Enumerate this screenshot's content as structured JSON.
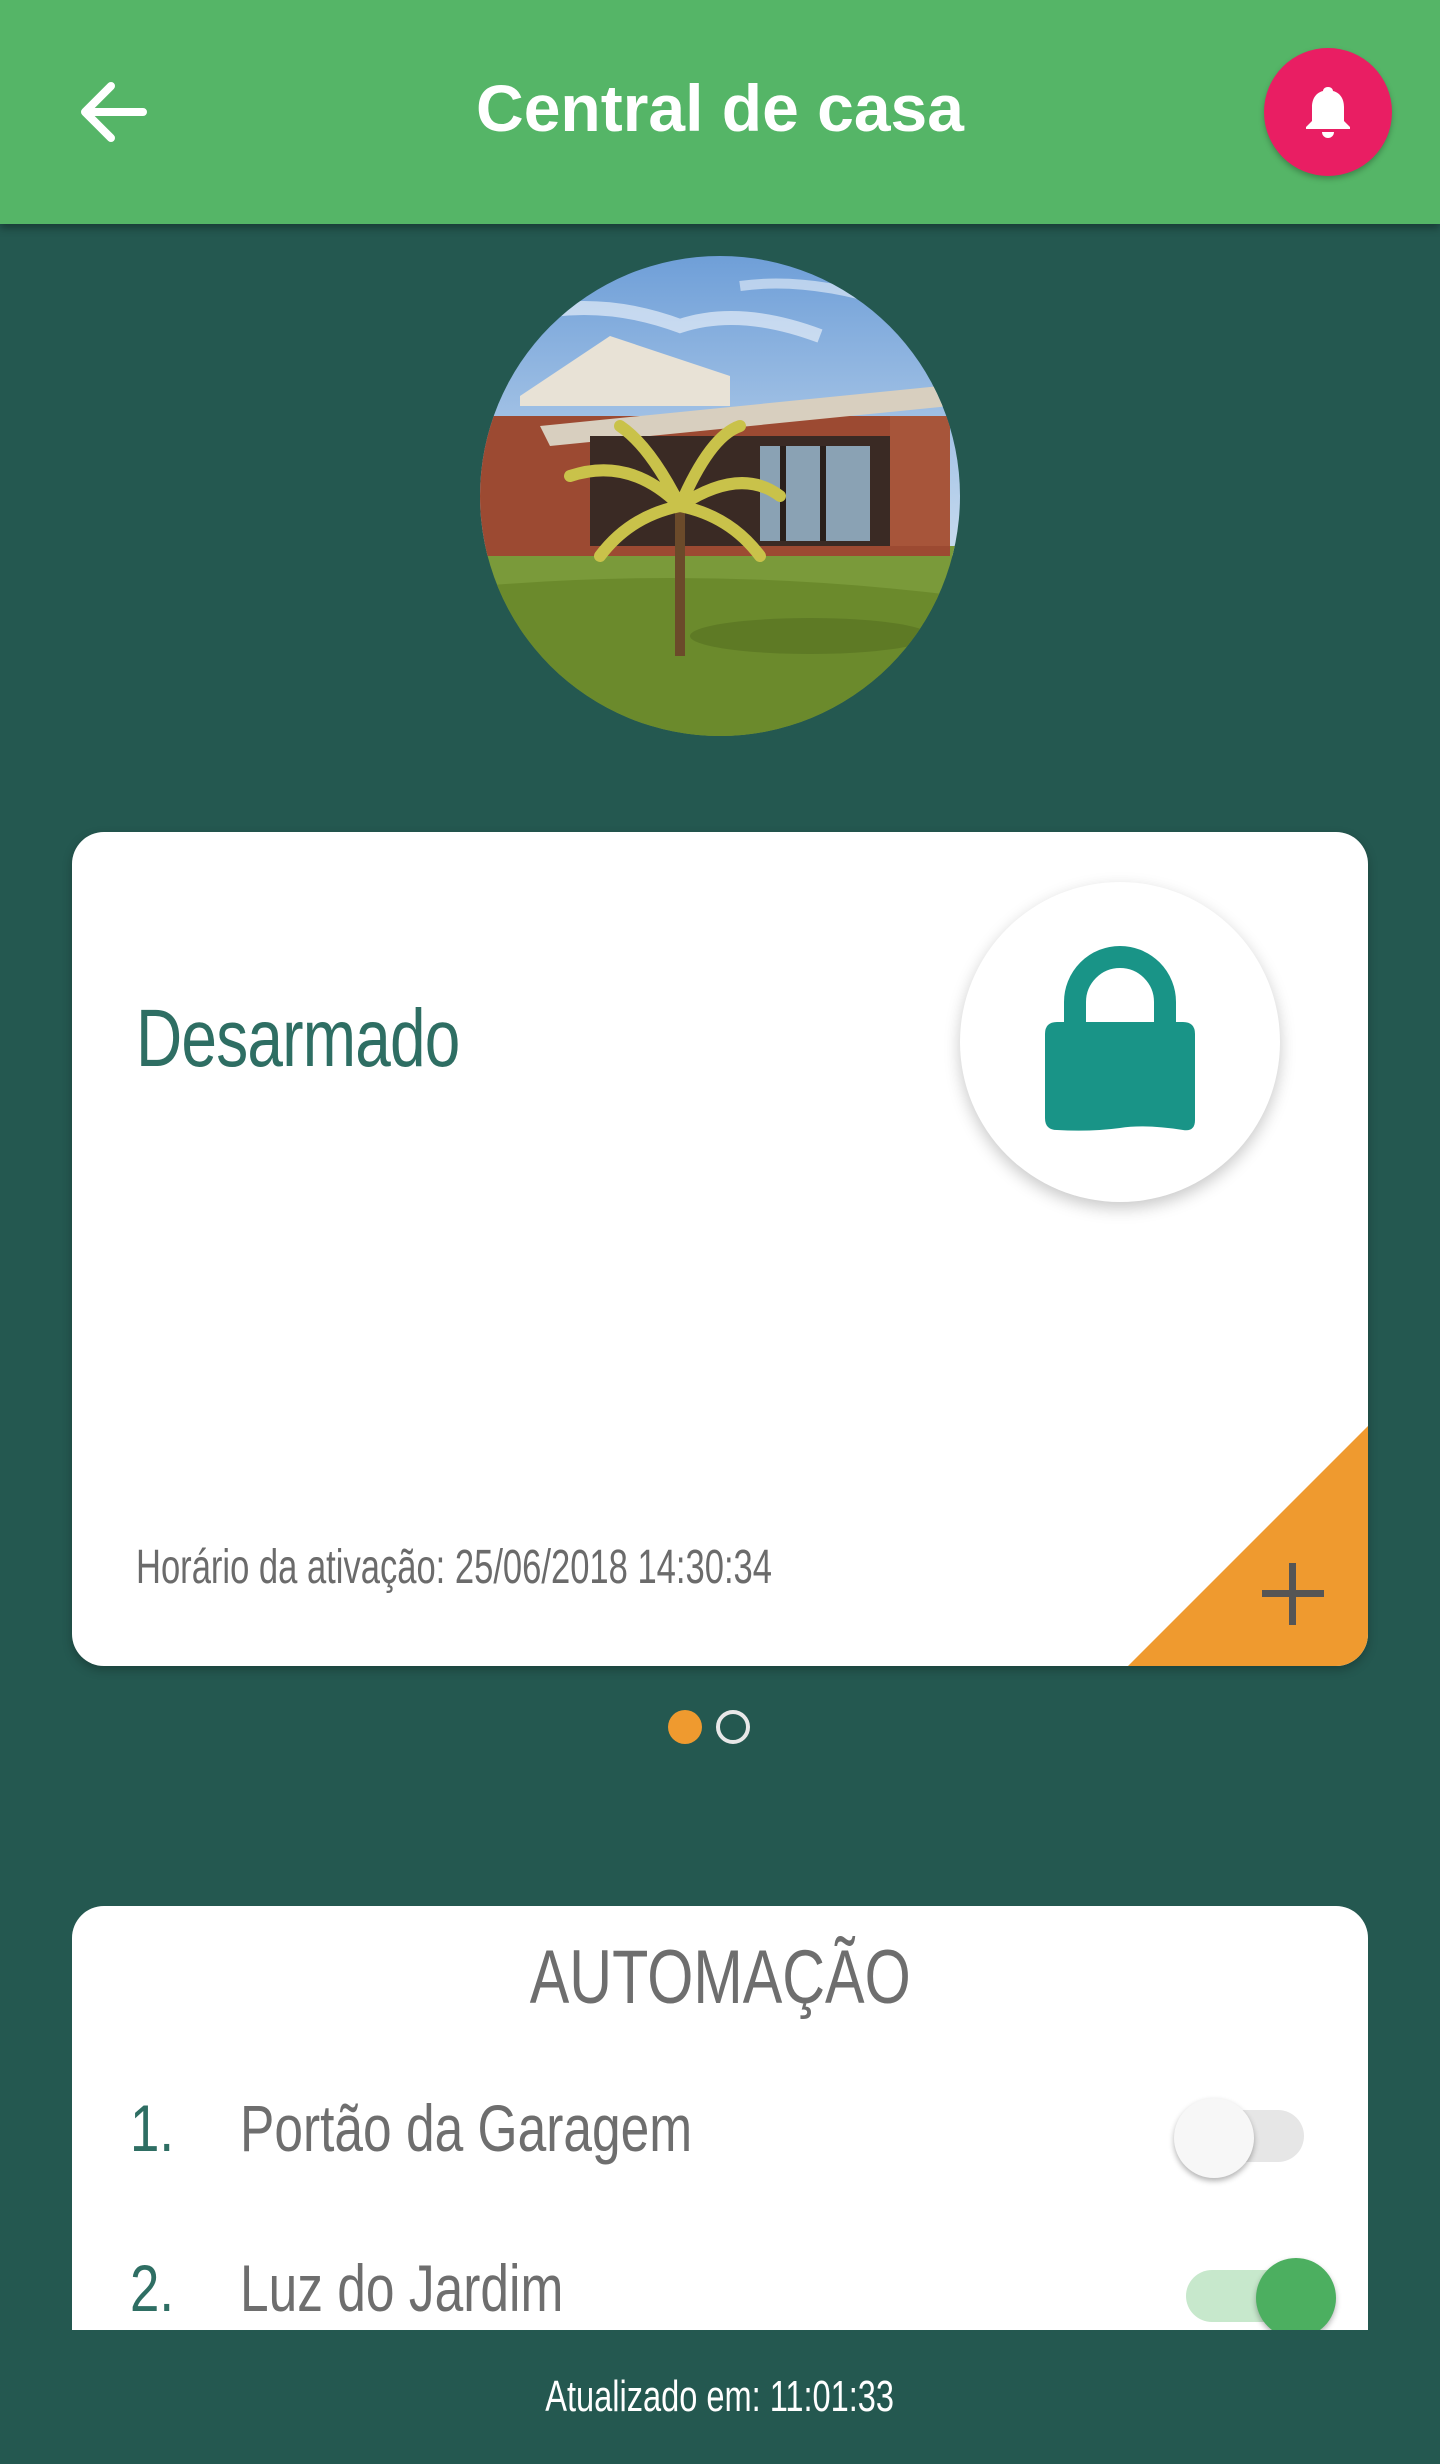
{
  "header": {
    "title": "Central de casa",
    "back_icon": "arrow-left-icon",
    "bell_icon": "bell-icon"
  },
  "status_card": {
    "status": "Desarmado",
    "lock_icon": "lock-icon",
    "activation_text": "Horário da ativação: 25/06/2018 14:30:34",
    "add_icon": "plus-icon"
  },
  "pagination": {
    "count": 2,
    "active_index": 0
  },
  "automation": {
    "title": "AUTOMAÇÃO",
    "items": [
      {
        "number": "1.",
        "label": "Portão da Garagem",
        "enabled": false
      },
      {
        "number": "2.",
        "label": "Luz do Jardim",
        "enabled": true
      }
    ]
  },
  "footer": {
    "updated": "Atualizado em: 11:01:33"
  },
  "colors": {
    "appbar": "#55b567",
    "background": "#245850",
    "alert": "#e91e63",
    "lock": "#199487",
    "accent_orange": "#ef9a2f",
    "status_text": "#2e6e63"
  }
}
